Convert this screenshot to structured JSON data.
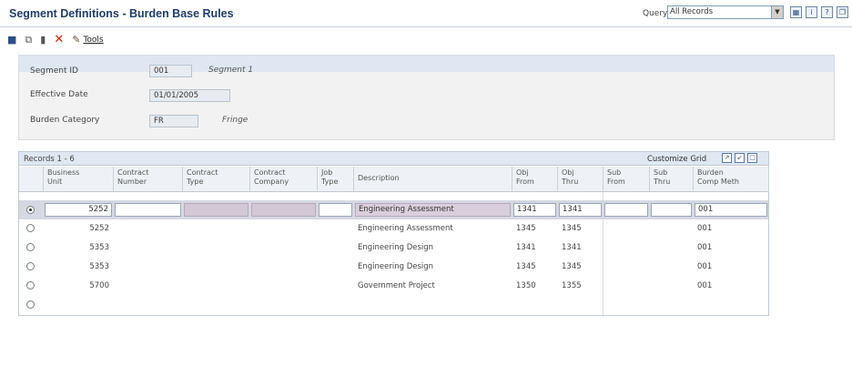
{
  "title": "Segment Definitions - Burden Base Rules",
  "query": {
    "label": "Query:",
    "value": "All Records"
  },
  "header_icons": [
    "grid-icon",
    "info-icon",
    "help-icon",
    "book-icon"
  ],
  "toolbar": {
    "tools_label": "Tools"
  },
  "header": {
    "segment_id_label": "Segment ID",
    "segment_id": "001",
    "segment_desc": "Segment 1",
    "effective_date_label": "Effective Date",
    "effective_date": "01/01/2005",
    "burden_category_label": "Burden Category",
    "burden_category": "FR",
    "burden_category_desc": "Fringe"
  },
  "grid": {
    "records": "Records 1 - 6",
    "customize": "Customize Grid",
    "columns": {
      "business_unit": [
        "Business",
        "Unit"
      ],
      "contract_number": [
        "Contract",
        "Number"
      ],
      "contract_type": [
        "Contract",
        "Type"
      ],
      "contract_company": [
        "Contract",
        "Company"
      ],
      "job_type": [
        "Job",
        "Type"
      ],
      "description": "Description",
      "obj_from": [
        "Obj",
        "From"
      ],
      "obj_thru": [
        "Obj",
        "Thru"
      ],
      "sub_from": [
        "Sub",
        "From"
      ],
      "sub_thru": [
        "Sub",
        "Thru"
      ],
      "burden_comp": [
        "Burden",
        "Comp Meth"
      ]
    },
    "rows": [
      {
        "bu": "5252",
        "desc": "Engineering Assessment",
        "obj_from": "1341",
        "obj_thru": "1341",
        "comp": "001"
      },
      {
        "bu": "5252",
        "desc": "Engineering Assessment",
        "obj_from": "1345",
        "obj_thru": "1345",
        "comp": "001"
      },
      {
        "bu": "5353",
        "desc": "Engineering Design",
        "obj_from": "1341",
        "obj_thru": "1341",
        "comp": "001"
      },
      {
        "bu": "5353",
        "desc": "Engineering Design",
        "obj_from": "1345",
        "obj_thru": "1345",
        "comp": "001"
      },
      {
        "bu": "5700",
        "desc": "Government Project",
        "obj_from": "1350",
        "obj_thru": "1355",
        "comp": "001"
      }
    ]
  }
}
